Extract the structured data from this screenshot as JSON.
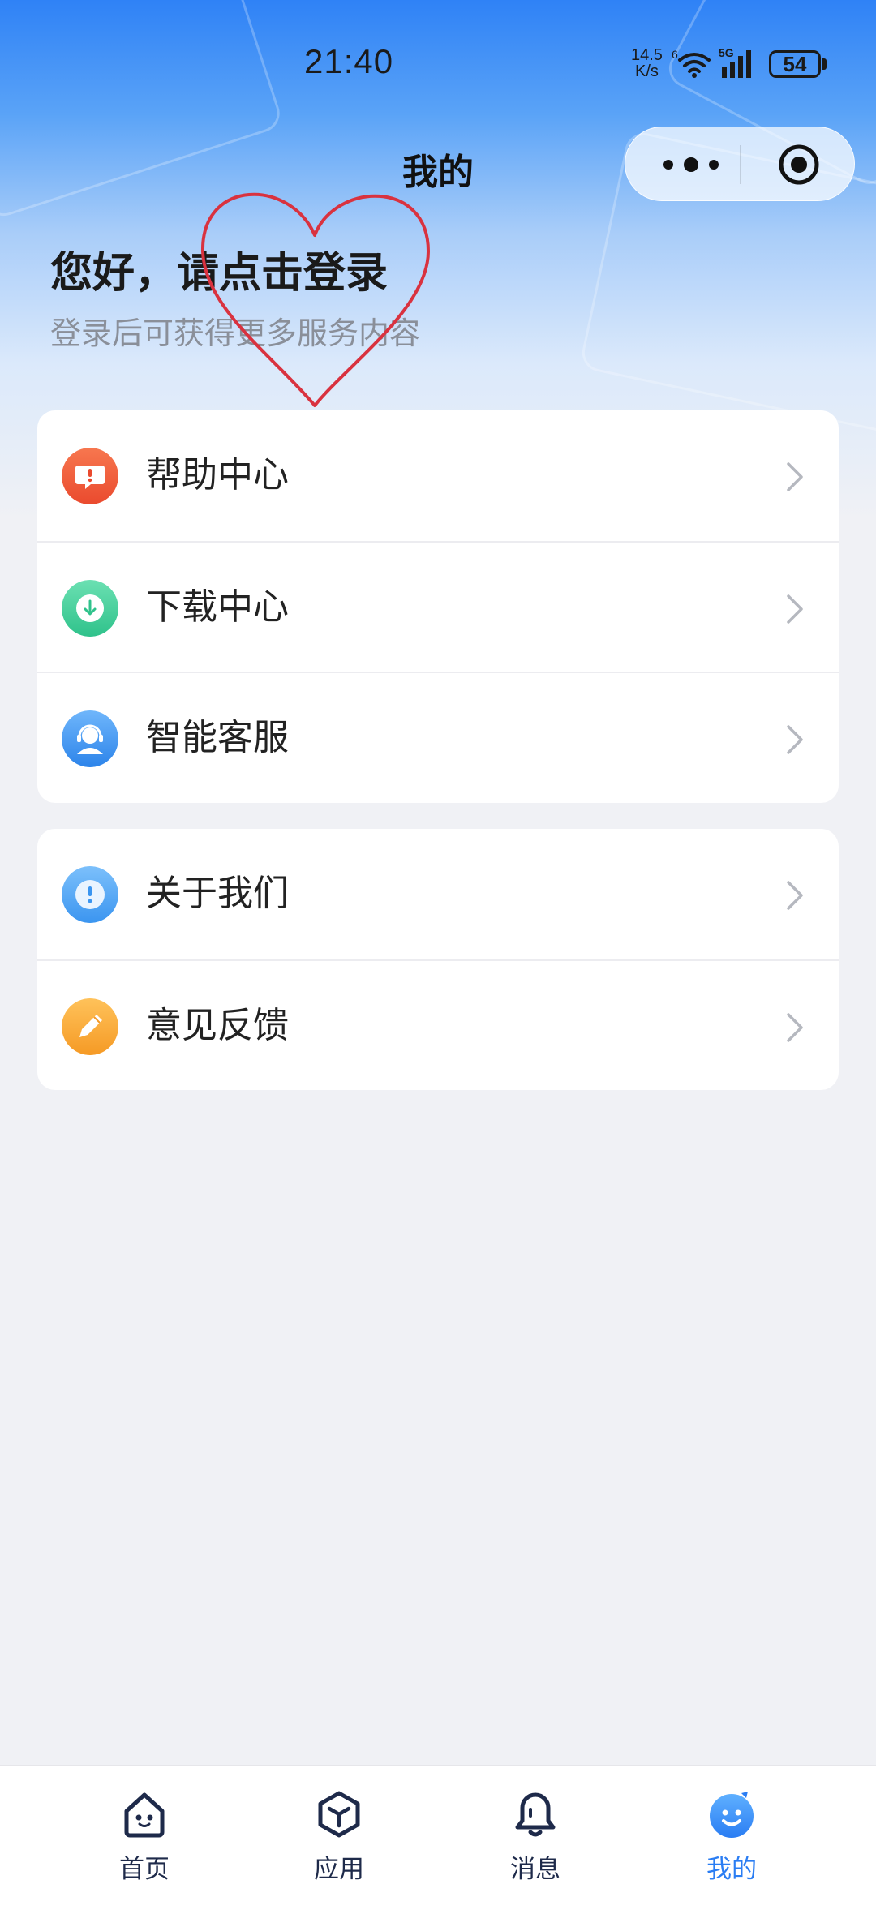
{
  "status_bar": {
    "time": "21:40",
    "net_speed_value": "14.5",
    "net_speed_unit": "K/s",
    "wifi_label": "6",
    "signal_label": "5G",
    "battery": "54"
  },
  "nav": {
    "title": "我的",
    "more_icon": "more-dots-icon",
    "close_icon": "target-circle-icon"
  },
  "profile": {
    "greeting": "您好，请点击登录",
    "subtitle": "登录后可获得更多服务内容"
  },
  "menu_group_1": [
    {
      "label": "帮助中心",
      "icon": "help-icon",
      "color": "#f05a3c"
    },
    {
      "label": "下载中心",
      "icon": "download-icon",
      "color": "#3ccf9a"
    },
    {
      "label": "智能客服",
      "icon": "customer-service-icon",
      "color": "#3d93f0"
    }
  ],
  "menu_group_2": [
    {
      "label": "关于我们",
      "icon": "about-icon",
      "color": "#4aa4f5"
    },
    {
      "label": "意见反馈",
      "icon": "feedback-icon",
      "color": "#f7a83a"
    }
  ],
  "tabbar": {
    "items": [
      {
        "label": "首页",
        "icon": "home-icon"
      },
      {
        "label": "应用",
        "icon": "apps-icon"
      },
      {
        "label": "消息",
        "icon": "bell-icon"
      },
      {
        "label": "我的",
        "icon": "profile-face-icon",
        "active": true
      }
    ],
    "active_color": "#2a7df3",
    "inactive_color": "#1e2a4a"
  },
  "annotation": {
    "shape": "heart-drawing",
    "color": "#d9323f"
  }
}
